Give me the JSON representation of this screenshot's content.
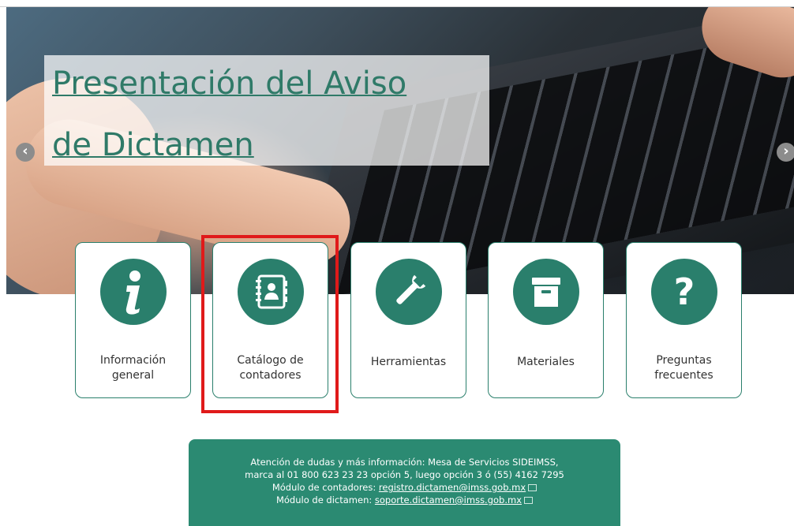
{
  "hero": {
    "title_line1": "Presentación del Aviso",
    "title_line2": "de Dictamen",
    "prev_arrow": "‹",
    "next_arrow": "›"
  },
  "cards": [
    {
      "label": "Información general",
      "icon": "info-icon"
    },
    {
      "label": "Catálogo de contadores",
      "icon": "address-book-icon"
    },
    {
      "label": "Herramientas",
      "icon": "wrench-icon"
    },
    {
      "label": "Materiales",
      "icon": "archive-box-icon"
    },
    {
      "label": "Preguntas frecuentes",
      "icon": "question-icon"
    }
  ],
  "info": {
    "line1": "Atención de dudas y más información: Mesa de Servicios SIDEIMSS,",
    "line2": "marca al 01 800 623 23 23 opción 5, luego opción 3 ó (55) 4162 7295",
    "contadores_label": "Módulo de contadores: ",
    "contadores_email": "registro.dictamen@imss.gob.mx",
    "dictamen_label": "Módulo de dictamen: ",
    "dictamen_email": "soporte.dictamen@imss.gob.mx"
  },
  "colors": {
    "accent": "#2a7f6c",
    "info_bg": "#2b8a72",
    "highlight": "#e01a1a"
  }
}
